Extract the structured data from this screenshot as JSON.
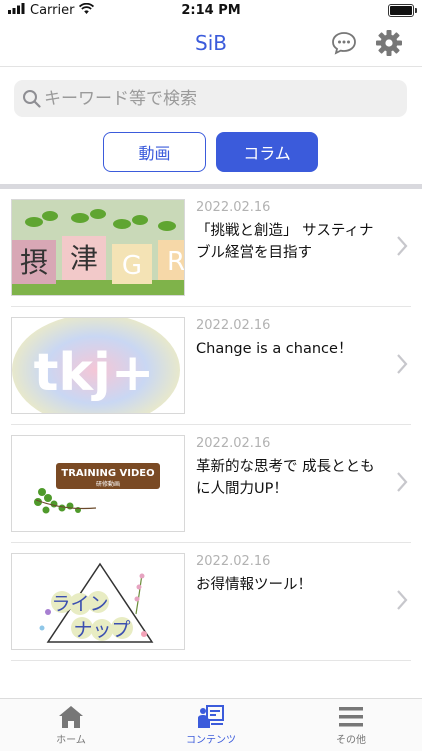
{
  "status_bar": {
    "carrier": "Carrier",
    "time": "2:14 PM"
  },
  "nav": {
    "title": "SiB"
  },
  "search": {
    "placeholder": "キーワード等で検索"
  },
  "segments": {
    "video": "動画",
    "column": "コラム",
    "selected": "column"
  },
  "items": [
    {
      "date": "2022.02.16",
      "title": "「挑戦と創造」 サスティナブル経営を目指す",
      "thumb_text": [
        "摂",
        "津",
        "G",
        "R"
      ]
    },
    {
      "date": "2022.02.16",
      "title": "Change is a chance！",
      "thumb_text": "tkj+"
    },
    {
      "date": "2022.02.16",
      "title": "革新的な思考で 成長とともに人間力UP！",
      "thumb_text": [
        "TRAINING VIDEO",
        "研修動画"
      ]
    },
    {
      "date": "2022.02.16",
      "title": "お得情報ツール！",
      "thumb_text": [
        "ライン",
        "ナップ"
      ]
    }
  ],
  "tabbar": {
    "home": "ホーム",
    "contents": "コンテンツ",
    "other": "その他",
    "active": "contents"
  },
  "colors": {
    "accent": "#3b5bdb"
  },
  "icons": [
    "wifi-icon",
    "chat-icon",
    "gear-icon",
    "search-icon",
    "chevron-right-icon",
    "home-icon",
    "contents-icon",
    "menu-icon"
  ]
}
